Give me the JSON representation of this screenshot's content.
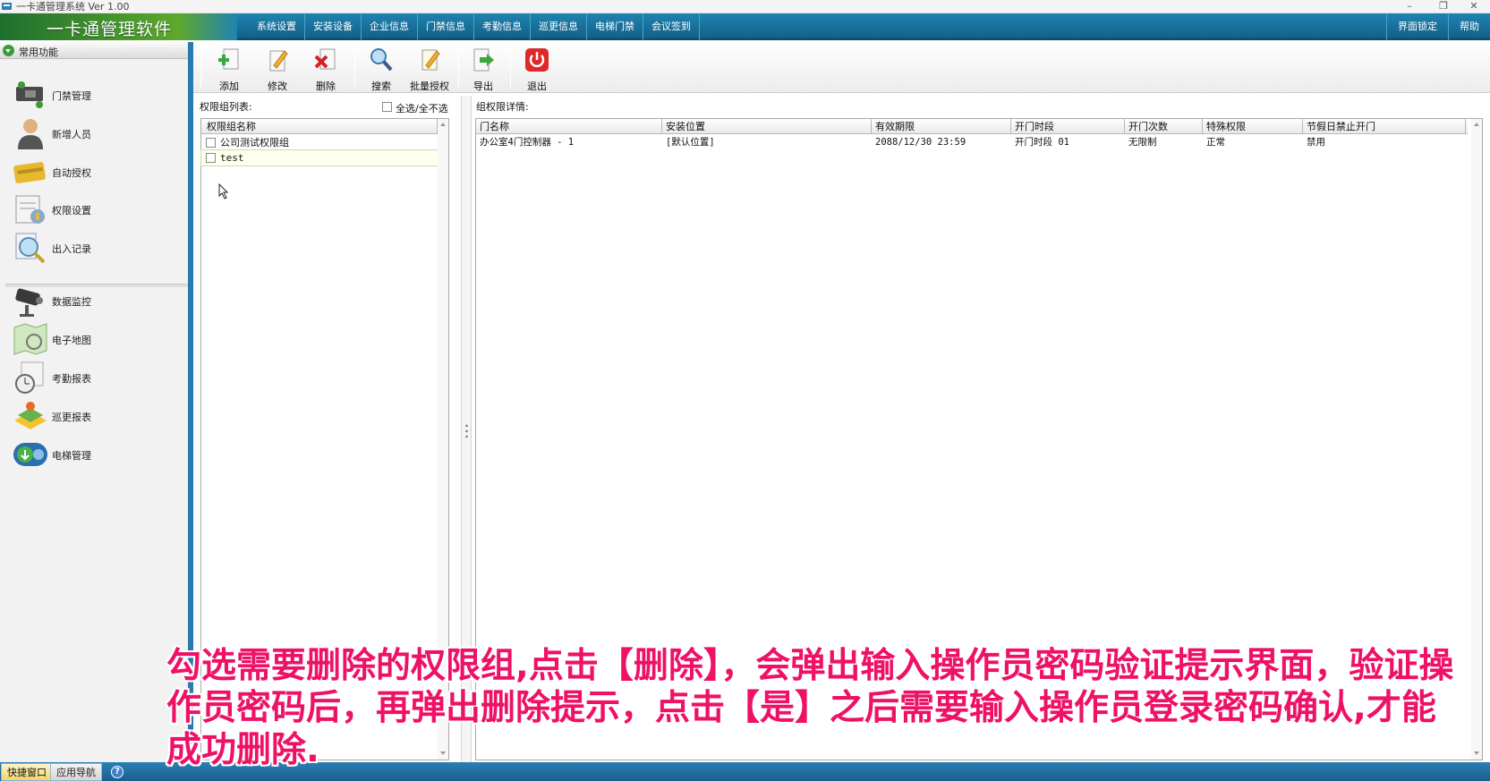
{
  "window": {
    "title": "一卡通管理系统  Ver 1.00",
    "controls": [
      "–",
      "❐",
      "✕"
    ]
  },
  "menubar": {
    "logo": "一卡通管理软件",
    "items": [
      "系统设置",
      "安装设备",
      "企业信息",
      "门禁信息",
      "考勤信息",
      "巡更信息",
      "电梯门禁",
      "会议签到"
    ],
    "right_items": [
      "界面锁定",
      "帮助"
    ]
  },
  "sidebar": {
    "header": "常用功能",
    "items": [
      {
        "label": "门禁管理",
        "icon": "door-controller-icon"
      },
      {
        "label": "新增人员",
        "icon": "person-icon"
      },
      {
        "label": "自动授权",
        "icon": "card-icon"
      },
      {
        "label": "权限设置",
        "icon": "permission-settings-icon"
      },
      {
        "label": "出入记录",
        "icon": "magnifier-record-icon"
      },
      {
        "label": "数据监控",
        "icon": "camera-monitor-icon"
      },
      {
        "label": "电子地图",
        "icon": "map-icon"
      },
      {
        "label": "考勤报表",
        "icon": "clock-report-icon"
      },
      {
        "label": "巡更报表",
        "icon": "patrol-report-icon"
      },
      {
        "label": "电梯管理",
        "icon": "elevator-icon"
      }
    ]
  },
  "toolbar": {
    "buttons": [
      {
        "label": "添加",
        "icon": "add-icon"
      },
      {
        "label": "修改",
        "icon": "edit-icon"
      },
      {
        "label": "删除",
        "icon": "delete-icon"
      },
      {
        "label": "搜索",
        "icon": "search-icon"
      },
      {
        "label": "批量授权",
        "icon": "batch-authorize-icon"
      },
      {
        "label": "导出",
        "icon": "export-icon"
      },
      {
        "label": "退出",
        "icon": "power-icon"
      }
    ]
  },
  "left_panel": {
    "title": "权限组列表:",
    "select_all": "全选/全不选",
    "column": "权限组名称",
    "rows": [
      "公司测试权限组",
      "test"
    ]
  },
  "right_panel": {
    "title": "组权限详情:",
    "columns": [
      "门名称",
      "安装位置",
      "有效期限",
      "开门时段",
      "开门次数",
      "特殊权限",
      "节假日禁止开门"
    ],
    "rows": [
      [
        "办公室4门控制器 - 1",
        "[默认位置]",
        "2088/12/30 23:59",
        "开门时段 01",
        "无限制",
        "正常",
        "禁用"
      ]
    ]
  },
  "statusbar": {
    "tabs": [
      "快捷窗口",
      "应用导航"
    ],
    "help": "?"
  },
  "caption": "勾选需要删除的权限组,点击【删除】，会弹出输入操作员密码验证提示界面，验证操作员密码后，再弹出删除提示，点击【是】之后需要输入操作员登录密码确认,才能成功删除."
}
